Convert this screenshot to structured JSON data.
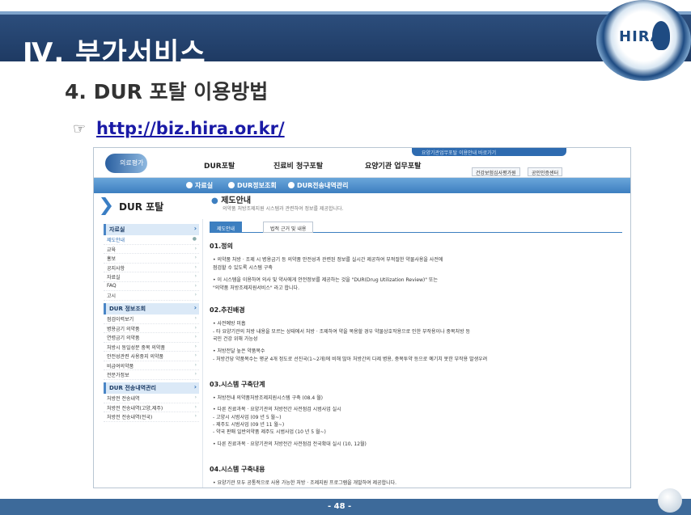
{
  "slide": {
    "title": "Ⅳ. 부가서비스",
    "logo_text": "HIRA",
    "subtitle": "4. DUR 포탈 이용방법",
    "hand_icon": "pointing-hand-icon",
    "url": "http://biz.hira.or.kr/",
    "page_number": "- 48 -"
  },
  "portal": {
    "logo_label": "의료평가",
    "nav": [
      "DUR포탈",
      "진료비 청구포탈",
      "요양기관 업무포탈"
    ],
    "top_notice": "요양기관업무포탈 이용안내 바로가기",
    "top_buttons": [
      "건강보험심사평가원",
      "공인인증센터"
    ],
    "subnav": [
      "자료실",
      "DUR정보조회",
      "DUR전송내역관리"
    ],
    "left_title": "DUR 포탈",
    "menu_groups": [
      {
        "header": "자료실",
        "items": [
          "제도안내",
          "교육",
          "홍보",
          "공지사항",
          "자료실",
          "FAQ",
          "고시"
        ]
      },
      {
        "header": "DUR 정보조회",
        "items": [
          "점검이력보기",
          "병용금기 의약품",
          "연령금기 의약품",
          "처방시 동일성분 중복 의약품",
          "안전성관련 사용중지 의약품",
          "비급여의약품",
          "전문가정보"
        ]
      },
      {
        "header": "DUR 전송내역관리",
        "items": [
          "처방전 전송내역",
          "처방전 전송내역(고양,제주)",
          "처방전 전송내역(전국)"
        ]
      }
    ],
    "content_title": "제도안내",
    "content_desc": "의약품 처방조제지원 시스템과 관련하여 정보를 제공합니다.",
    "tabs": [
      "제도안내",
      "법적 근거 및 내용"
    ],
    "sections": [
      {
        "heading": "01.정의",
        "lines": [
          "• 의약품 처방 · 조제 시 병용금기 등 의약품 안전성과 관련된 정보를 실시간 제공하여 부적절한 약물사용을 사전에",
          "   점검할 수 있도록 시스템 구축",
          "• 이 시스템을 이용하여 의사 및 약사에게 안전정보를 제공하는 것을 \"DUR(Drug Utilization Review)\" 또는",
          "   \"의약품 처방조제지원서비스\" 라고 합니다."
        ]
      },
      {
        "heading": "02.추진배경",
        "lines": [
          "• 사전예방 미흡",
          "  - 타 요양기관의 처방 내용을 모르는 상태에서 처방 · 조제하여 약을 복용할 경우 약물상호작용으로 인한 부작용이나 중복처방 등",
          "    국민 건강 위해 가능성",
          "• 처방전달 높은 약품목수",
          "  - 처방건당 약품목수는 평균 4개 정도로 선진국(1~2개)에 비해 많아 처방간의 다제 병용, 중복투약 등으로 예기치 못한 부작용 발생우려"
        ]
      },
      {
        "heading": "03.시스템 구축단계",
        "lines": [
          "• 처방전내 의약품처방조제지원시스템 구축 (08.4 월)",
          "• 다른 진료과목 · 요양기관의 처방전간 사전점검 시범사업 실시",
          "  - 고양시 시범사업 (09 년 5 월~)",
          "  - 제주도 시범사업 (09 년 11 월~)",
          "  - 약국 판매 일반의약품 제주도 시범사업 (10 년 5 월~)",
          "• 다른 진료과목 · 요양기관의 처방전간 사전점검 전국확대 실시 (10, 12월)"
        ]
      },
      {
        "heading": "04.시스템 구축내용",
        "lines": [
          "• 요양기관 모두 공통적으로 사용 가능한 처방 · 조제지원 프로그램을 개발하여 제공합니다."
        ]
      }
    ]
  }
}
